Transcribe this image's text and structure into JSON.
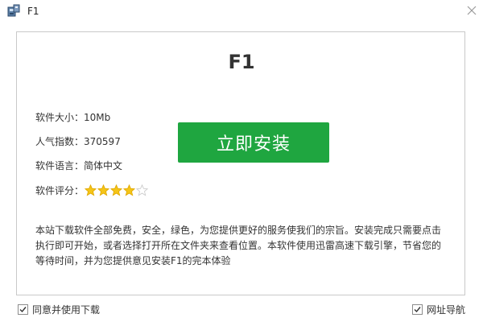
{
  "window": {
    "title": "F1",
    "icon": "installer-package-icon",
    "close_icon": "close-icon"
  },
  "product": {
    "name": "F1"
  },
  "info": {
    "size_label": "软件大小：",
    "size_value": "10Mb",
    "popularity_label": "人气指数：",
    "popularity_value": "370597",
    "language_label": "软件语言：",
    "language_value": "简体中文",
    "rating_label": "软件评分：",
    "rating_value": 4,
    "rating_max": 5
  },
  "install_button": {
    "label": "立即安装"
  },
  "description": "本站下载软件全部免费，安全，绿色，为您提供更好的服务使我们的宗旨。安装完成只需要点击执行即可开始，或者选择打开所在文件夹来查看位置。本软件使用迅雷高速下载引擎，节省您的等待时间，并为您提供意见安装F1的完本体验",
  "footer": {
    "agree_label": "同意并使用下载",
    "agree_checked": true,
    "nav_label": "网址导航",
    "nav_checked": true
  },
  "colors": {
    "accent_green": "#1fa640",
    "star_filled": "#f5c518",
    "star_empty": "#c8c8c8",
    "panel_border": "#c9c9c9"
  }
}
